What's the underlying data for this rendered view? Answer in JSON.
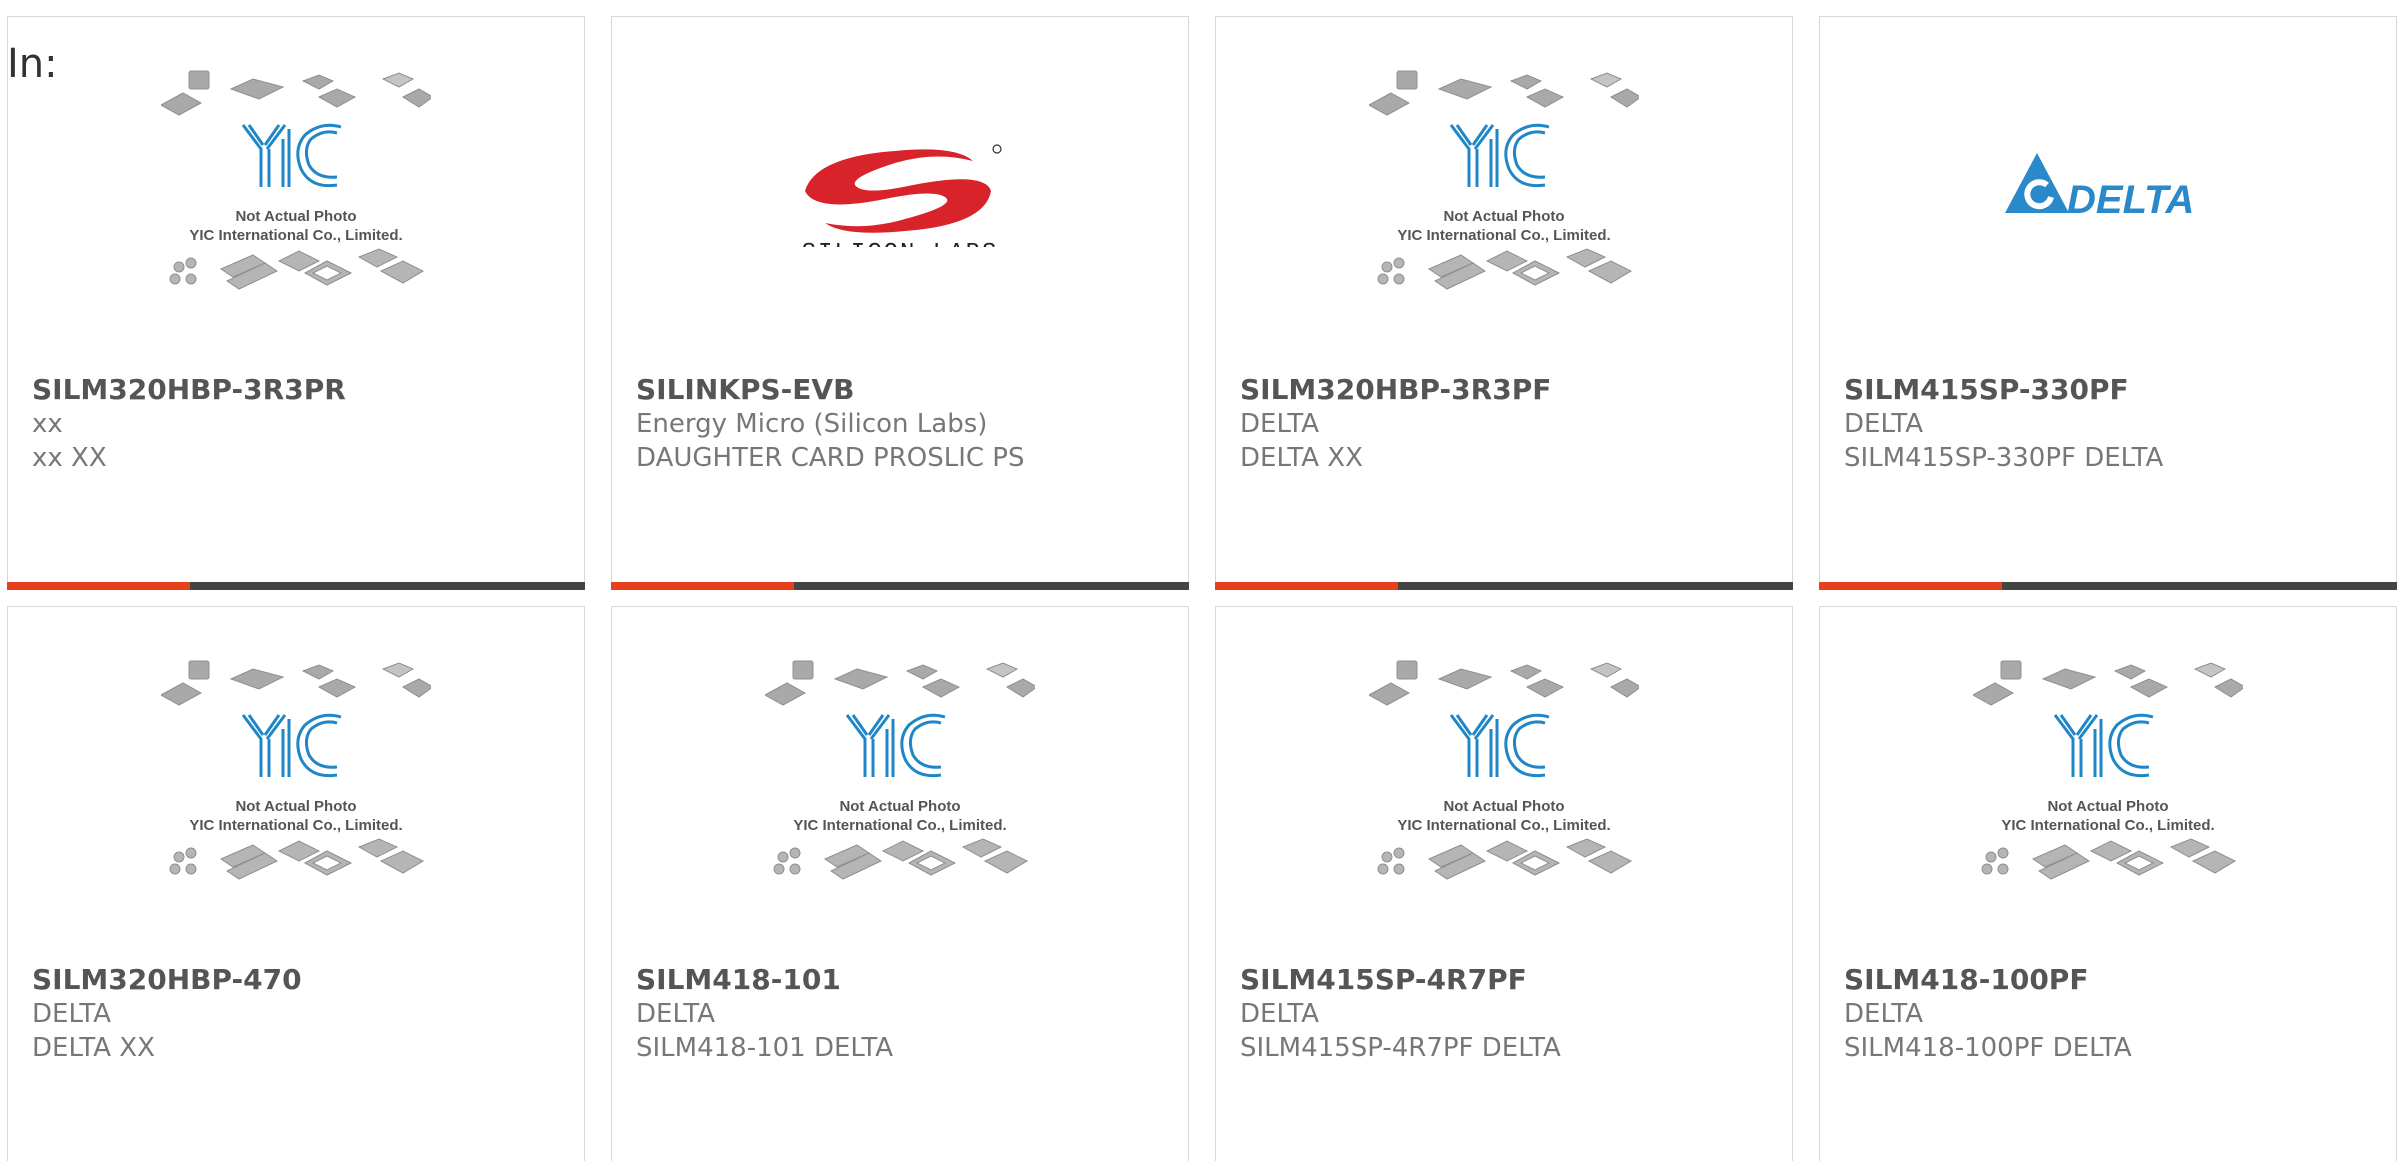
{
  "filter": {
    "in_label": "In:"
  },
  "colors": {
    "accent": "#e8401c",
    "bar": "#444444",
    "yic_blue": "#1f87c7",
    "silicon_red": "#d8232a",
    "delta_blue": "#2a8ac9"
  },
  "placeholder": {
    "line1": "Not Actual Photo",
    "line2": "YIC International Co., Limited.",
    "logo": "YIC"
  },
  "logos": {
    "silicon_labs": "SILICON LABS",
    "delta": "DELTA"
  },
  "products": [
    {
      "part": "SILM320HBP-3R3PR",
      "manufacturer": "xx",
      "description": "xx XX",
      "image": "yic-placeholder"
    },
    {
      "part": "SILINKPS-EVB",
      "manufacturer": "Energy Micro (Silicon Labs)",
      "description": "DAUGHTER CARD PROSLIC PS",
      "image": "silicon-labs-logo"
    },
    {
      "part": "SILM320HBP-3R3PF",
      "manufacturer": "DELTA",
      "description": "DELTA XX",
      "image": "yic-placeholder"
    },
    {
      "part": "SILM415SP-330PF",
      "manufacturer": "DELTA",
      "description": "SILM415SP-330PF DELTA",
      "image": "delta-logo"
    },
    {
      "part": "SILM320HBP-470",
      "manufacturer": "DELTA",
      "description": "DELTA XX",
      "image": "yic-placeholder"
    },
    {
      "part": "SILM418-101",
      "manufacturer": "DELTA",
      "description": "SILM418-101 DELTA",
      "image": "yic-placeholder"
    },
    {
      "part": "SILM415SP-4R7PF",
      "manufacturer": "DELTA",
      "description": "SILM415SP-4R7PF DELTA",
      "image": "yic-placeholder"
    },
    {
      "part": "SILM418-100PF",
      "manufacturer": "DELTA",
      "description": "SILM418-100PF DELTA",
      "image": "yic-placeholder"
    }
  ]
}
